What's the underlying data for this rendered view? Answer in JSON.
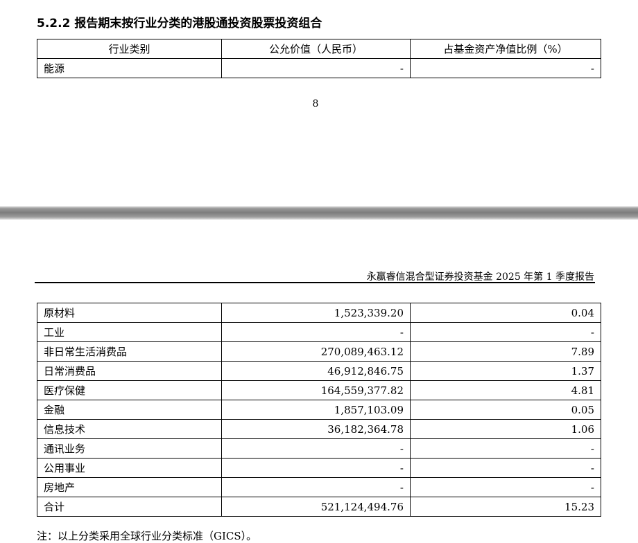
{
  "section": {
    "title": "5.2.2 报告期末按行业分类的港股通投资股票投资组合"
  },
  "table_top": {
    "headers": [
      "行业类别",
      "公允价值（人民币）",
      "占基金资产净值比例（%）"
    ],
    "rows": [
      {
        "category": "能源",
        "value": "-",
        "ratio": "-"
      }
    ]
  },
  "page_number": "8",
  "running_header": "永赢睿信混合型证券投资基金 2025 年第 1 季度报告",
  "table_bottom": {
    "rows": [
      {
        "category": "原材料",
        "value": "1,523,339.20",
        "ratio": "0.04"
      },
      {
        "category": "工业",
        "value": "-",
        "ratio": "-"
      },
      {
        "category": "非日常生活消费品",
        "value": "270,089,463.12",
        "ratio": "7.89"
      },
      {
        "category": "日常消费品",
        "value": "46,912,846.75",
        "ratio": "1.37"
      },
      {
        "category": "医疗保健",
        "value": "164,559,377.82",
        "ratio": "4.81"
      },
      {
        "category": "金融",
        "value": "1,857,103.09",
        "ratio": "0.05"
      },
      {
        "category": "信息技术",
        "value": "36,182,364.78",
        "ratio": "1.06"
      },
      {
        "category": "通讯业务",
        "value": "-",
        "ratio": "-"
      },
      {
        "category": "公用事业",
        "value": "-",
        "ratio": "-"
      },
      {
        "category": "房地产",
        "value": "-",
        "ratio": "-"
      },
      {
        "category": "合计",
        "value": "521,124,494.76",
        "ratio": "15.23"
      }
    ]
  },
  "note": "注：以上分类采用全球行业分类标准（GICS）。"
}
